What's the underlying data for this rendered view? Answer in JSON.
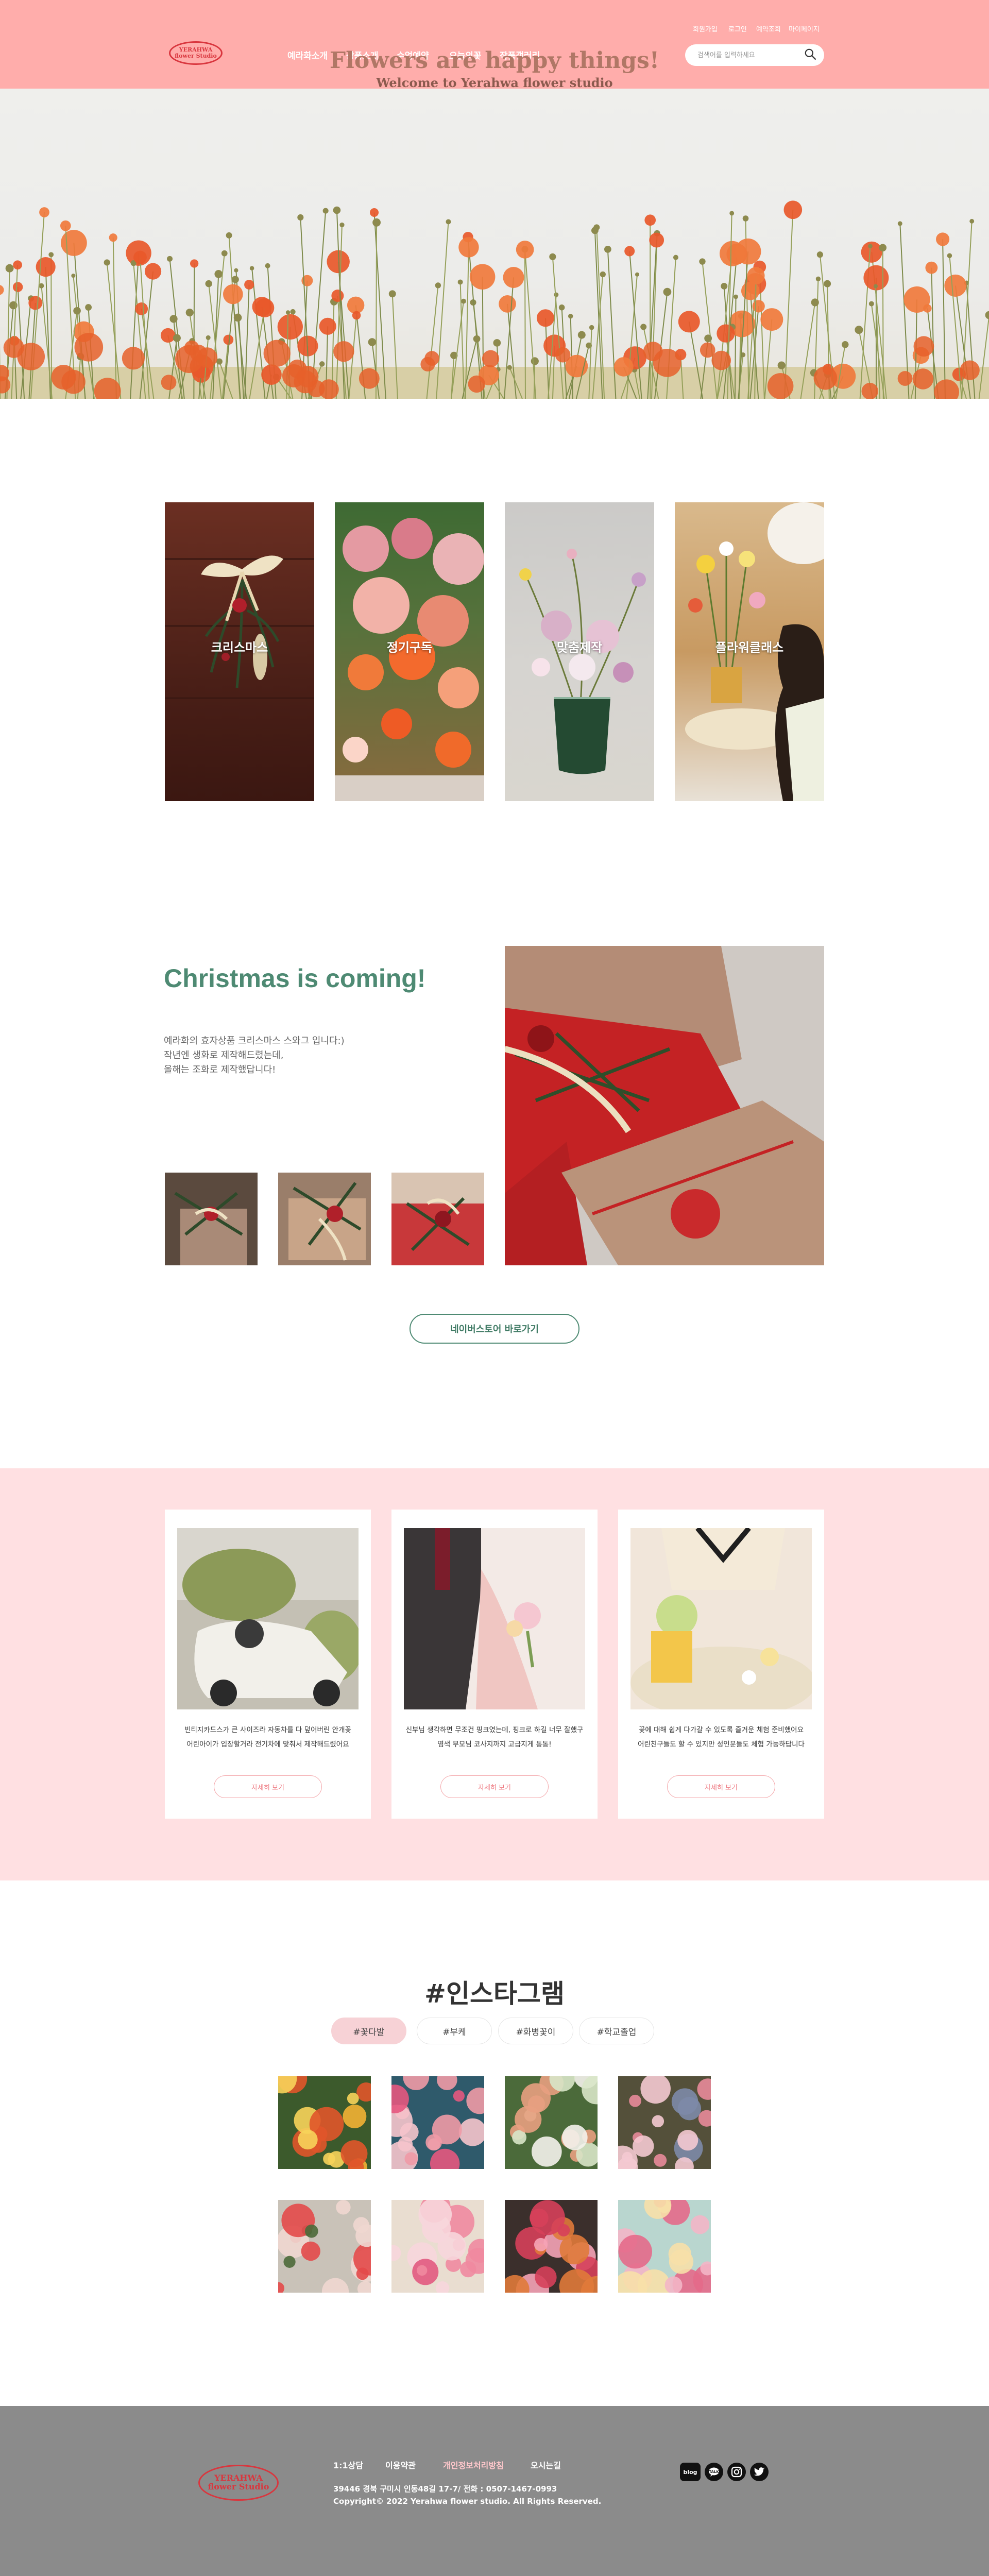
{
  "header": {
    "logo_top": "YERAHWA",
    "logo_bottom": "flower Studio",
    "nav": [
      "예라화소개",
      "상품소개",
      "수업예약",
      "오늘의꽃",
      "작품갤러리"
    ],
    "util": [
      "회원가입",
      "로그인",
      "예약조회",
      "마이페이지"
    ],
    "search_placeholder": "검색어를 입력하세요"
  },
  "hero": {
    "title": "Flowers are happy things!",
    "subtitle": "Welcome to Yerahwa flower studio"
  },
  "categories": [
    "크리스마스",
    "정기구독",
    "맞춤제작",
    "플라워클래스"
  ],
  "christmas": {
    "title": "Christmas is coming!",
    "lines": [
      "예라화의 효자상품 크리스마스 스와그 입니다:)",
      "작년엔 생화로 제작해드렸는데,",
      "올해는 조화로 제작했답니다!"
    ],
    "button": "네이버스토어 바로가기"
  },
  "cards": [
    {
      "lines": [
        "빈티지카드스가 큰 사이즈라 자동차를 다 덮어버린 안개꽃",
        "어린아이가 입장할거라 전기차에 맞춰서 제작해드렸어요"
      ],
      "button": "자세히 보기"
    },
    {
      "lines": [
        "신부님 생각하면 무조건 핑크였는데, 핑크로 하길 너무 잘했구",
        "염색 부모님 코사지까지 고급지게 통통!"
      ],
      "button": "자세히 보기"
    },
    {
      "lines": [
        "꽃에 대해 쉽게 다가갈 수 있도록 즐거운 체험 준비했어요",
        "어린친구들도 할 수 있지만 성인분들도 체험 가능하답니다"
      ],
      "button": "자세히 보기"
    }
  ],
  "instagram": {
    "title": "#인스타그램",
    "tags": [
      "#꽃다발",
      "#부케",
      "#화병꽃이",
      "#학교졸업"
    ]
  },
  "footer": {
    "logo_top": "YERAHWA",
    "logo_bottom": "flower Studio",
    "links": [
      "1:1상담",
      "이용약관",
      "개인정보처리방침",
      "오시는길"
    ],
    "address": "39446 경북 구미시 인동48길 17-7/ 전화 : 0507-1467-0993",
    "copyright": "Copyright© 2022 Yerahwa flower studio. All Rights Reserved.",
    "sns": [
      "blog",
      "talk",
      "instagram",
      "twitter"
    ]
  },
  "colors": {
    "header_bg": "#ffadab",
    "pink_section_bg": "#ffe0e2",
    "accent_green": "#4e8a73",
    "footer_bg": "#8b8b8b",
    "privacy_link": "#ffc8cc"
  }
}
